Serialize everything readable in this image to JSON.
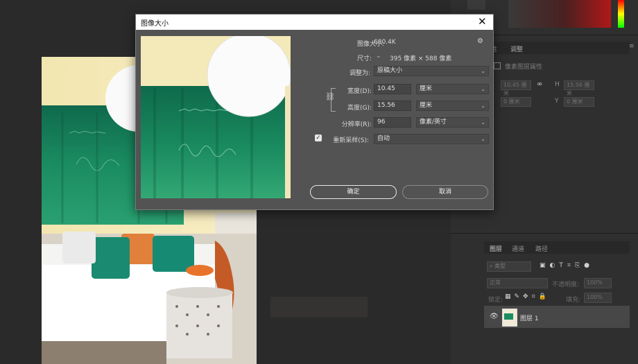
{
  "dialog": {
    "title": "图像大小",
    "close_glyph": "✕",
    "image_size_label": "图像大小:",
    "image_size_value": "680.4K",
    "gear_glyph": "⚙",
    "dimensions_label": "尺寸:",
    "dimensions_value": "395 像素 × 588 像素",
    "fit_to_label": "调整为:",
    "fit_to_value": "原稿大小",
    "width_label": "宽度(D):",
    "width_value": "10.45",
    "width_unit": "厘米",
    "height_label": "高度(G):",
    "height_value": "15.56",
    "height_unit": "厘米",
    "resolution_label": "分辨率(R):",
    "resolution_value": "96",
    "resolution_unit": "像素/英寸",
    "resample_label": "重新采样(S):",
    "resample_checked": true,
    "resample_value": "自动",
    "ok_label": "确定",
    "cancel_label": "取消"
  },
  "right_panel": {
    "properties_tabs": [
      "性",
      "调整"
    ],
    "properties_subtitle": "像素图层属性",
    "props_w_value": "10.45 厘米",
    "props_h_label": "H",
    "props_h_value": "15.56 厘米",
    "props_x_value": "0 厘米",
    "props_y_label": "Y",
    "props_y_value": "0 厘米",
    "layers_tabs": [
      "图层",
      "通道",
      "路径"
    ],
    "layer_filter": "类型",
    "blend_mode": "正常",
    "opacity_label": "不透明度:",
    "opacity_value": "100%",
    "lock_label": "锁定:",
    "fill_label": "填充:",
    "fill_value": "100%",
    "layer_name": "图层 1"
  },
  "colors": {
    "background": "#2a2a2a",
    "dialog_bg": "#535353",
    "accent_green": "#1e8a62"
  }
}
